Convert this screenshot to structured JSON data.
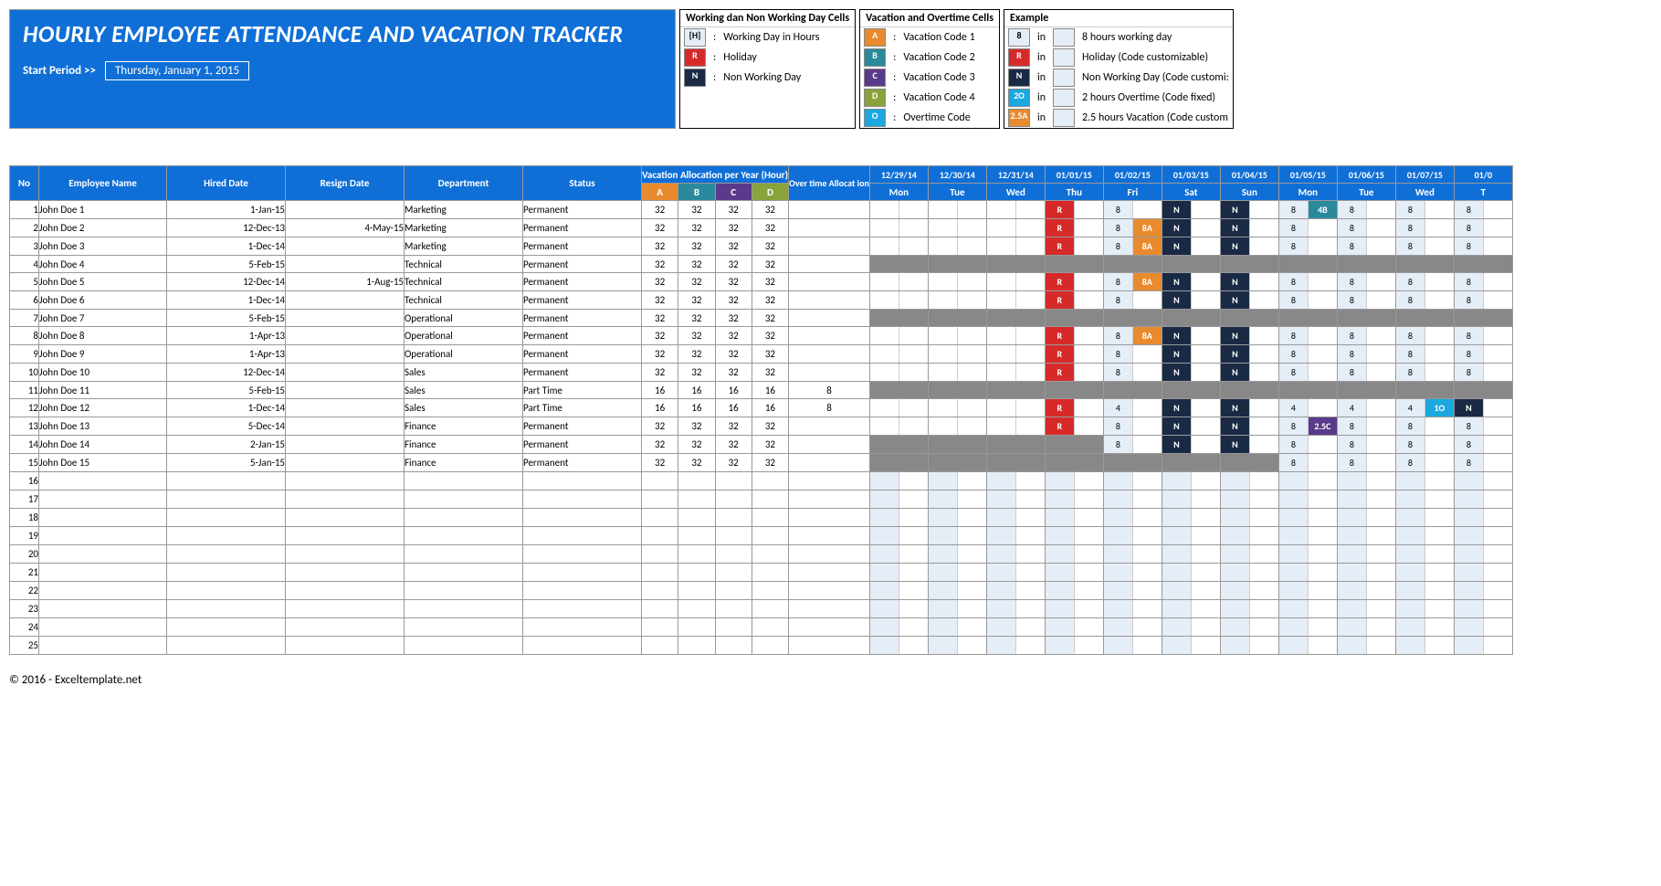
{
  "title": "HOURLY EMPLOYEE ATTENDANCE AND VACATION TRACKER",
  "start_label": "Start Period >>",
  "start_value": "Thursday, January 1, 2015",
  "legend1": {
    "title": "Working dan Non Working Day Cells",
    "rows": [
      {
        "code": "[H]",
        "bg": "#e5edf7",
        "color": "#000",
        "desc": "Working Day in Hours"
      },
      {
        "code": "R",
        "bg": "#d62a2a",
        "color": "#fff",
        "desc": "Holiday"
      },
      {
        "code": "N",
        "bg": "#1a2a45",
        "color": "#fff",
        "desc": "Non Working Day"
      }
    ]
  },
  "legend2": {
    "title": "Vacation and Overtime Cells",
    "rows": [
      {
        "code": "A",
        "bg": "#e88b2e",
        "desc": "Vacation Code 1"
      },
      {
        "code": "B",
        "bg": "#2a8a9c",
        "desc": "Vacation Code 2"
      },
      {
        "code": "C",
        "bg": "#5a3a8a",
        "desc": "Vacation Code 3"
      },
      {
        "code": "D",
        "bg": "#8aa33a",
        "desc": "Vacation Code 4"
      },
      {
        "code": "O",
        "bg": "#1ba8e0",
        "desc": "Overtime Code"
      }
    ]
  },
  "legend3": {
    "title": "Example",
    "rows": [
      {
        "code": "8",
        "bg": "#e5edf7",
        "color": "#000",
        "desc": "8 hours working day"
      },
      {
        "code": "R",
        "bg": "#d62a2a",
        "desc": "Holiday (Code customizable)"
      },
      {
        "code": "N",
        "bg": "#1a2a45",
        "desc": "Non Working Day (Code customi:"
      },
      {
        "code": "2O",
        "bg": "#1ba8e0",
        "desc": "2 hours Overtime (Code fixed)"
      },
      {
        "code": "2.5A",
        "bg": "#e88b2e",
        "desc": "2.5 hours Vacation (Code custom"
      }
    ]
  },
  "headers": {
    "no": "No",
    "name": "Employee Name",
    "hired": "Hired Date",
    "resign": "Resign Date",
    "dept": "Department",
    "status": "Status",
    "vac_alloc": "Vacation Allocation per Year (Hour)",
    "ot": "Over time Allocat ion",
    "dates": [
      "12/29/14",
      "12/30/14",
      "12/31/14",
      "01/01/15",
      "01/02/15",
      "01/03/15",
      "01/04/15",
      "01/05/15",
      "01/06/15",
      "01/07/15",
      "01/0"
    ],
    "dows": [
      "Mon",
      "Tue",
      "Wed",
      "Thu",
      "Fri",
      "Sat",
      "Sun",
      "Mon",
      "Tue",
      "Wed",
      "T"
    ]
  },
  "alloc_subs": [
    "A",
    "B",
    "C",
    "D"
  ],
  "rows": [
    {
      "no": 1,
      "name": "John Doe 1",
      "hired": "1-Jan-15",
      "resign": "",
      "dept": "Marketing",
      "status": "Permanent",
      "a": [
        32,
        32,
        32,
        32
      ],
      "ot": "",
      "cal": [
        [
          "",
          ""
        ],
        [
          "",
          ""
        ],
        [
          "",
          ""
        ],
        [
          "R",
          ""
        ],
        [
          "8",
          ""
        ],
        [
          "N",
          ""
        ],
        [
          "N",
          ""
        ],
        [
          "8",
          "4B"
        ],
        [
          "8",
          ""
        ],
        [
          "8",
          ""
        ],
        [
          "8",
          ""
        ]
      ]
    },
    {
      "no": 2,
      "name": "John Doe 2",
      "hired": "12-Dec-13",
      "resign": "4-May-15",
      "dept": "Marketing",
      "status": "Permanent",
      "a": [
        32,
        32,
        32,
        32
      ],
      "ot": "",
      "cal": [
        [
          "",
          ""
        ],
        [
          "",
          ""
        ],
        [
          "",
          ""
        ],
        [
          "R",
          ""
        ],
        [
          "8",
          "8A"
        ],
        [
          "N",
          ""
        ],
        [
          "N",
          ""
        ],
        [
          "8",
          ""
        ],
        [
          "8",
          ""
        ],
        [
          "8",
          ""
        ],
        [
          "8",
          ""
        ]
      ]
    },
    {
      "no": 3,
      "name": "John Doe 3",
      "hired": "1-Dec-14",
      "resign": "",
      "dept": "Marketing",
      "status": "Permanent",
      "a": [
        32,
        32,
        32,
        32
      ],
      "ot": "",
      "cal": [
        [
          "",
          ""
        ],
        [
          "",
          ""
        ],
        [
          "",
          ""
        ],
        [
          "R",
          ""
        ],
        [
          "8",
          "8A"
        ],
        [
          "N",
          ""
        ],
        [
          "N",
          ""
        ],
        [
          "8",
          ""
        ],
        [
          "8",
          ""
        ],
        [
          "8",
          ""
        ],
        [
          "8",
          ""
        ]
      ]
    },
    {
      "no": 4,
      "name": "John Doe 4",
      "hired": "5-Feb-15",
      "resign": "",
      "dept": "Technical",
      "status": "Permanent",
      "a": [
        32,
        32,
        32,
        32
      ],
      "ot": "",
      "grey": true
    },
    {
      "no": 5,
      "name": "John Doe 5",
      "hired": "12-Dec-14",
      "resign": "1-Aug-15",
      "dept": "Technical",
      "status": "Permanent",
      "a": [
        32,
        32,
        32,
        32
      ],
      "ot": "",
      "cal": [
        [
          "",
          ""
        ],
        [
          "",
          ""
        ],
        [
          "",
          ""
        ],
        [
          "R",
          ""
        ],
        [
          "8",
          "8A"
        ],
        [
          "N",
          ""
        ],
        [
          "N",
          ""
        ],
        [
          "8",
          ""
        ],
        [
          "8",
          ""
        ],
        [
          "8",
          ""
        ],
        [
          "8",
          ""
        ]
      ]
    },
    {
      "no": 6,
      "name": "John Doe 6",
      "hired": "1-Dec-14",
      "resign": "",
      "dept": "Technical",
      "status": "Permanent",
      "a": [
        32,
        32,
        32,
        32
      ],
      "ot": "",
      "cal": [
        [
          "",
          ""
        ],
        [
          "",
          ""
        ],
        [
          "",
          ""
        ],
        [
          "R",
          ""
        ],
        [
          "8",
          ""
        ],
        [
          "N",
          ""
        ],
        [
          "N",
          ""
        ],
        [
          "8",
          ""
        ],
        [
          "8",
          ""
        ],
        [
          "8",
          ""
        ],
        [
          "8",
          ""
        ]
      ]
    },
    {
      "no": 7,
      "name": "John Doe 7",
      "hired": "5-Feb-15",
      "resign": "",
      "dept": "Operational",
      "status": "Permanent",
      "a": [
        32,
        32,
        32,
        32
      ],
      "ot": "",
      "grey": true
    },
    {
      "no": 8,
      "name": "John Doe 8",
      "hired": "1-Apr-13",
      "resign": "",
      "dept": "Operational",
      "status": "Permanent",
      "a": [
        32,
        32,
        32,
        32
      ],
      "ot": "",
      "cal": [
        [
          "",
          ""
        ],
        [
          "",
          ""
        ],
        [
          "",
          ""
        ],
        [
          "R",
          ""
        ],
        [
          "8",
          "8A"
        ],
        [
          "N",
          ""
        ],
        [
          "N",
          ""
        ],
        [
          "8",
          ""
        ],
        [
          "8",
          ""
        ],
        [
          "8",
          ""
        ],
        [
          "8",
          ""
        ]
      ]
    },
    {
      "no": 9,
      "name": "John Doe 9",
      "hired": "1-Apr-13",
      "resign": "",
      "dept": "Operational",
      "status": "Permanent",
      "a": [
        32,
        32,
        32,
        32
      ],
      "ot": "",
      "cal": [
        [
          "",
          ""
        ],
        [
          "",
          ""
        ],
        [
          "",
          ""
        ],
        [
          "R",
          ""
        ],
        [
          "8",
          ""
        ],
        [
          "N",
          ""
        ],
        [
          "N",
          ""
        ],
        [
          "8",
          ""
        ],
        [
          "8",
          ""
        ],
        [
          "8",
          ""
        ],
        [
          "8",
          ""
        ]
      ]
    },
    {
      "no": 10,
      "name": "John Doe 10",
      "hired": "12-Dec-14",
      "resign": "",
      "dept": "Sales",
      "status": "Permanent",
      "a": [
        32,
        32,
        32,
        32
      ],
      "ot": "",
      "cal": [
        [
          "",
          ""
        ],
        [
          "",
          ""
        ],
        [
          "",
          ""
        ],
        [
          "R",
          ""
        ],
        [
          "8",
          ""
        ],
        [
          "N",
          ""
        ],
        [
          "N",
          ""
        ],
        [
          "8",
          ""
        ],
        [
          "8",
          ""
        ],
        [
          "8",
          ""
        ],
        [
          "8",
          ""
        ]
      ]
    },
    {
      "no": 11,
      "name": "John Doe 11",
      "hired": "5-Feb-15",
      "resign": "",
      "dept": "Sales",
      "status": "Part Time",
      "a": [
        16,
        16,
        16,
        16
      ],
      "ot": "8",
      "grey": true
    },
    {
      "no": 12,
      "name": "John Doe 12",
      "hired": "1-Dec-14",
      "resign": "",
      "dept": "Sales",
      "status": "Part Time",
      "a": [
        16,
        16,
        16,
        16
      ],
      "ot": "8",
      "cal": [
        [
          "",
          ""
        ],
        [
          "",
          ""
        ],
        [
          "",
          ""
        ],
        [
          "R",
          ""
        ],
        [
          "4",
          ""
        ],
        [
          "N",
          ""
        ],
        [
          "N",
          ""
        ],
        [
          "4",
          ""
        ],
        [
          "4",
          ""
        ],
        [
          "4",
          "1O"
        ],
        [
          "N",
          ""
        ]
      ]
    },
    {
      "no": 13,
      "name": "John Doe 13",
      "hired": "5-Dec-14",
      "resign": "",
      "dept": "Finance",
      "status": "Permanent",
      "a": [
        32,
        32,
        32,
        32
      ],
      "ot": "",
      "cal": [
        [
          "",
          ""
        ],
        [
          "",
          ""
        ],
        [
          "",
          ""
        ],
        [
          "R",
          ""
        ],
        [
          "8",
          ""
        ],
        [
          "N",
          ""
        ],
        [
          "N",
          ""
        ],
        [
          "8",
          "2.5C"
        ],
        [
          "8",
          ""
        ],
        [
          "8",
          ""
        ],
        [
          "8",
          ""
        ]
      ]
    },
    {
      "no": 14,
      "name": "John Doe 14",
      "hired": "2-Jan-15",
      "resign": "",
      "dept": "Finance",
      "status": "Permanent",
      "a": [
        32,
        32,
        32,
        32
      ],
      "ot": "",
      "cal": [
        [
          "G",
          ""
        ],
        [
          "G",
          ""
        ],
        [
          "G",
          ""
        ],
        [
          "G",
          ""
        ],
        [
          "8",
          ""
        ],
        [
          "N",
          ""
        ],
        [
          "N",
          ""
        ],
        [
          "8",
          ""
        ],
        [
          "8",
          ""
        ],
        [
          "8",
          ""
        ],
        [
          "8",
          ""
        ]
      ]
    },
    {
      "no": 15,
      "name": "John Doe 15",
      "hired": "5-Jan-15",
      "resign": "",
      "dept": "Finance",
      "status": "Permanent",
      "a": [
        32,
        32,
        32,
        32
      ],
      "ot": "",
      "cal": [
        [
          "G",
          ""
        ],
        [
          "G",
          ""
        ],
        [
          "G",
          ""
        ],
        [
          "G",
          ""
        ],
        [
          "G",
          ""
        ],
        [
          "G",
          ""
        ],
        [
          "G",
          ""
        ],
        [
          "8",
          ""
        ],
        [
          "8",
          ""
        ],
        [
          "8",
          ""
        ],
        [
          "8",
          ""
        ]
      ]
    }
  ],
  "empty_rows": [
    16,
    17,
    18,
    19,
    20,
    21,
    22,
    23,
    24,
    25
  ],
  "footer": "© 2016 - Exceltemplate.net"
}
